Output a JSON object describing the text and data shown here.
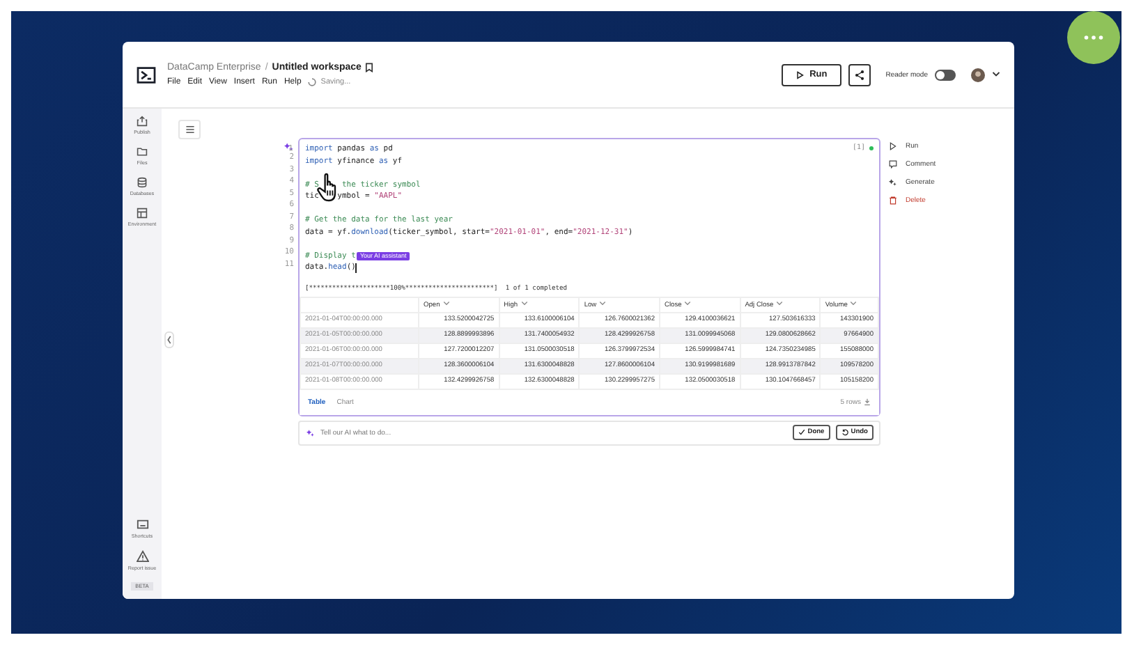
{
  "header": {
    "org": "DataCamp Enterprise",
    "separator": "/",
    "title": "Untitled workspace",
    "menu": [
      "File",
      "Edit",
      "View",
      "Insert",
      "Run",
      "Help"
    ],
    "status": "Saving...",
    "run_button": "Run",
    "reader_mode": {
      "label": "Reader mode",
      "on": false
    }
  },
  "sidebar": {
    "items": [
      {
        "label": "Publish",
        "kind": "publish"
      },
      {
        "label": "Files",
        "kind": "files"
      },
      {
        "label": "Databases",
        "kind": "databases"
      },
      {
        "label": "Environment",
        "kind": "environment"
      }
    ],
    "bottom_items": [
      {
        "label": "Shortcuts",
        "kind": "shortcuts"
      },
      {
        "label": "Report issue",
        "kind": "report"
      }
    ],
    "badge": "BETA"
  },
  "cell": {
    "exec_count": "[1]",
    "ai_badge": "Your AI assistant",
    "lines": [
      {
        "number": "1",
        "tokens": [
          {
            "t": "import",
            "kind": "kw"
          },
          {
            "t": " pandas ",
            "kind": "plain"
          },
          {
            "t": "as",
            "kind": "kw"
          },
          {
            "t": " pd",
            "kind": "plain"
          }
        ]
      },
      {
        "number": "2",
        "tokens": [
          {
            "t": "import",
            "kind": "kw"
          },
          {
            "t": " yfinance ",
            "kind": "plain"
          },
          {
            "t": "as",
            "kind": "kw"
          },
          {
            "t": " yf",
            "kind": "plain"
          }
        ]
      },
      {
        "number": "3"
      },
      {
        "number": "4",
        "tokens": [
          {
            "t": "# S     the ticker symbol",
            "kind": "cm"
          }
        ]
      },
      {
        "number": "5",
        "tokens": [
          {
            "t": "tic    ymbol = ",
            "kind": "plain"
          },
          {
            "t": "\"AAPL\"",
            "kind": "str"
          }
        ]
      },
      {
        "number": "6"
      },
      {
        "number": "7",
        "tokens": [
          {
            "t": "# Get the data for the last year",
            "kind": "cm"
          }
        ]
      },
      {
        "number": "8",
        "tokens": [
          {
            "t": "data = yf.",
            "kind": "plain"
          },
          {
            "t": "download",
            "kind": "fn"
          },
          {
            "t": "(ticker_symbol, start=",
            "kind": "plain"
          },
          {
            "t": "\"2021-01-01\"",
            "kind": "str"
          },
          {
            "t": ", end=",
            "kind": "plain"
          },
          {
            "t": "\"2021-12-31\"",
            "kind": "str"
          },
          {
            "t": ")",
            "kind": "plain"
          }
        ]
      },
      {
        "number": "9"
      },
      {
        "number": "10",
        "tokens": [
          {
            "t": "# Display t",
            "kind": "cm"
          }
        ],
        "badge": true
      },
      {
        "number": "11",
        "tokens": [
          {
            "t": "data.",
            "kind": "plain"
          },
          {
            "t": "head",
            "kind": "fn"
          },
          {
            "t": "()",
            "kind": "plain"
          }
        ]
      }
    ],
    "progress": "[*********************100%***********************]  1 of 1 completed",
    "table": {
      "columns": [
        "",
        "Open",
        "High",
        "Low",
        "Close",
        "Adj Close",
        "Volume"
      ],
      "rows": [
        [
          "2021-01-04T00:00:00.000",
          "133.5200042725",
          "133.6100006104",
          "126.7600021362",
          "129.4100036621",
          "127.503616333",
          "143301900"
        ],
        [
          "2021-01-05T00:00:00.000",
          "128.8899993896",
          "131.7400054932",
          "128.4299926758",
          "131.0099945068",
          "129.0800628662",
          "97664900"
        ],
        [
          "2021-01-06T00:00:00.000",
          "127.7200012207",
          "131.0500030518",
          "126.3799972534",
          "126.5999984741",
          "124.7350234985",
          "155088000"
        ],
        [
          "2021-01-07T00:00:00.000",
          "128.3600006104",
          "131.6300048828",
          "127.8600006104",
          "130.9199981689",
          "128.9913787842",
          "109578200"
        ],
        [
          "2021-01-08T00:00:00.000",
          "132.4299926758",
          "132.6300048828",
          "130.2299957275",
          "132.0500030518",
          "130.1047668457",
          "105158200"
        ]
      ]
    },
    "view_tabs": [
      {
        "label": "Table",
        "selected": true
      },
      {
        "label": "Chart",
        "selected": false
      }
    ],
    "row_count": "5 rows"
  },
  "ai_prompt": {
    "placeholder": "Tell our AI what to do...",
    "done": "Done",
    "undo": "Undo"
  },
  "cell_actions": [
    {
      "label": "Run",
      "kind": "run"
    },
    {
      "label": "Comment",
      "kind": "comment"
    },
    {
      "label": "Generate",
      "kind": "generate"
    },
    {
      "label": "Delete",
      "kind": "delete"
    }
  ]
}
